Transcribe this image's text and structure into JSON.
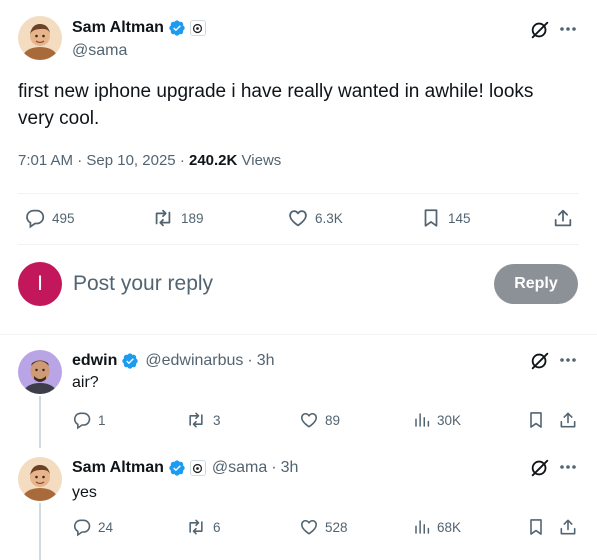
{
  "main_tweet": {
    "author_name": "Sam Altman",
    "author_handle": "@sama",
    "text": "first new iphone upgrade i have really wanted in awhile! looks very cool.",
    "time": "7:01 AM",
    "date": "Sep 10, 2025",
    "views_count": "240.2K",
    "views_label": "Views",
    "stats": {
      "replies": "495",
      "reposts": "189",
      "likes": "6.3K",
      "bookmarks": "145"
    }
  },
  "composer": {
    "avatar_letter": "I",
    "placeholder": "Post your reply",
    "button_label": "Reply"
  },
  "replies": [
    {
      "author_name": "edwin",
      "author_handle": "@edwinarbus",
      "age": "3h",
      "text": "air?",
      "stats": {
        "replies": "1",
        "reposts": "3",
        "likes": "89",
        "views": "30K"
      }
    },
    {
      "author_name": "Sam Altman",
      "author_handle": "@sama",
      "age": "3h",
      "text": "yes",
      "stats": {
        "replies": "24",
        "reposts": "6",
        "likes": "528",
        "views": "68K"
      }
    }
  ],
  "colors": {
    "brand_blue": "#1d9bf0",
    "text": "#0f1419",
    "muted": "#536471",
    "reply_avatar": "#c2185b",
    "reply_button": "#8b9196"
  }
}
